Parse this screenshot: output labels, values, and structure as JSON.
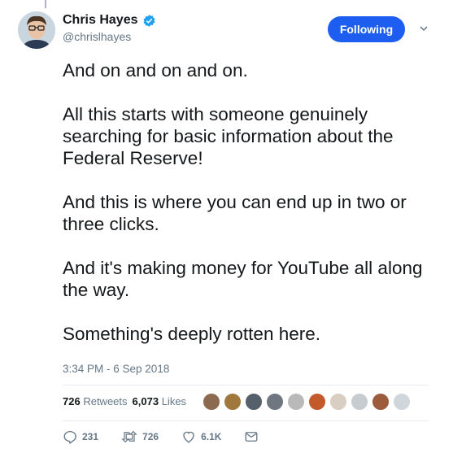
{
  "author": {
    "display_name": "Chris Hayes",
    "handle": "@chrislhayes",
    "avatar_icon": "profile-photo",
    "verified_icon": "verified-badge-icon"
  },
  "follow_button": {
    "label": "Following",
    "color": "#1d5ef0"
  },
  "tweet": {
    "paragraphs": [
      "And on and on and on.",
      "All this starts with someone genuinely searching for basic information about the Federal Reserve!",
      "And this is where you can end up in two or three clicks.",
      "And it's making money for YouTube all along the way.",
      "Something's deeply rotten here."
    ],
    "timestamp": "3:34 PM - 6 Sep 2018"
  },
  "stats": {
    "retweets_count": "726",
    "retweets_label": "Retweets",
    "likes_count": "6,073",
    "likes_label": "Likes"
  },
  "actions": {
    "reply_count": "231",
    "retweet_count": "726",
    "like_count": "6.1K"
  },
  "colors": {
    "text": "#14171a",
    "secondary": "#657786",
    "accent": "#1da1f2"
  }
}
